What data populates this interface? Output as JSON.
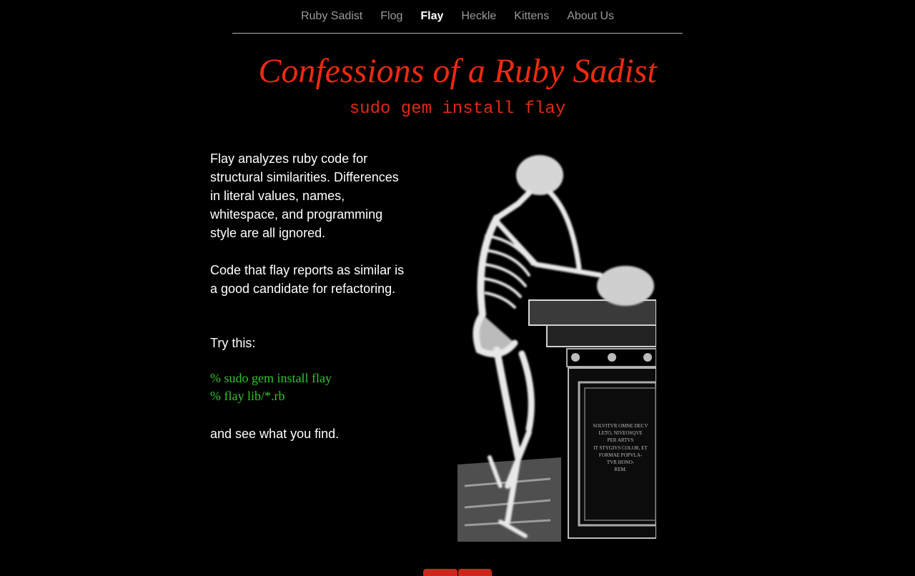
{
  "nav": {
    "items": [
      {
        "label": "Ruby Sadist",
        "active": false
      },
      {
        "label": "Flog",
        "active": false
      },
      {
        "label": "Flay",
        "active": true
      },
      {
        "label": "Heckle",
        "active": false
      },
      {
        "label": "Kittens",
        "active": false
      },
      {
        "label": "About Us",
        "active": false
      }
    ]
  },
  "header": {
    "title": "Confessions of a Ruby Sadist",
    "subtitle": "sudo gem install flay"
  },
  "content": {
    "paragraph1": "Flay analyzes ruby code for structural similarities. Differences in literal values, names, whitespace, and programming style are all ignored.",
    "paragraph2": "Code that flay reports as similar is a good candidate for refactoring.",
    "try_label": "Try this:",
    "commands": [
      "% sudo gem install flay",
      "% flay lib/*.rb"
    ],
    "closing": "and see what you find."
  },
  "illustration": {
    "subject": "skeleton-leaning-on-tomb",
    "inscription": [
      "SOLVITVR OMNE DECV",
      "LETO, NIVEOSQVE",
      "PER ARTVS",
      "IT STYGIVS COLOR, ET",
      "FORMAE POPVLA-",
      "TVR HONO-",
      "REM."
    ]
  },
  "colors": {
    "background": "#000000",
    "title": "#ee2a0e",
    "command": "#2fc52a",
    "nav_inactive": "#9a9a9a",
    "nav_active": "#ffffff"
  }
}
